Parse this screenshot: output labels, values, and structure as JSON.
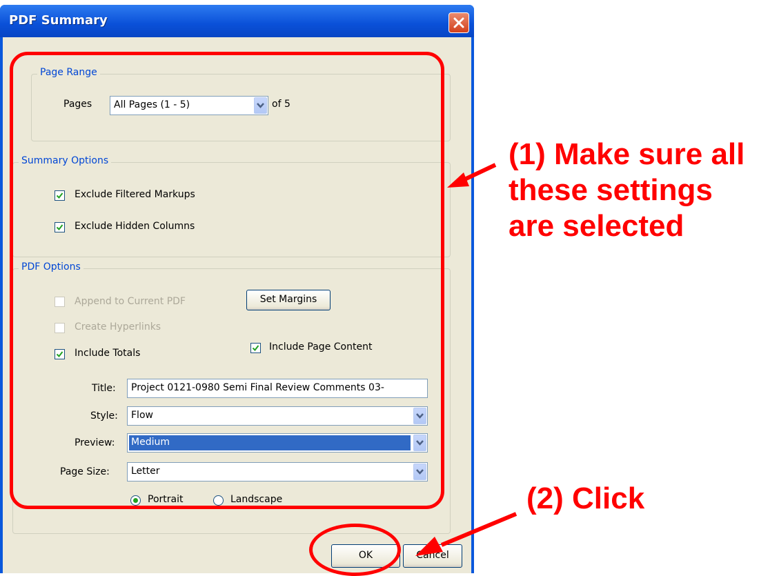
{
  "window": {
    "title": "PDF Summary"
  },
  "page_range": {
    "legend": "Page Range",
    "pages_label": "Pages",
    "pages_value": "All Pages (1 - 5)",
    "of_text": "of 5"
  },
  "summary_options": {
    "legend": "Summary Options",
    "exclude_filtered": {
      "label": "Exclude Filtered Markups",
      "checked": true
    },
    "exclude_hidden": {
      "label": "Exclude Hidden Columns",
      "checked": true
    }
  },
  "pdf_options": {
    "legend": "PDF Options",
    "append": {
      "label": "Append to Current PDF",
      "checked": false,
      "enabled": false
    },
    "set_margins_label": "Set Margins",
    "hyperlinks": {
      "label": "Create Hyperlinks",
      "checked": false,
      "enabled": false
    },
    "include_totals": {
      "label": "Include Totals",
      "checked": true
    },
    "include_page_content": {
      "label": "Include Page Content",
      "checked": true
    },
    "title_label": "Title:",
    "title_value": "Project 0121-0980 Semi Final Review Comments 03-",
    "style_label": "Style:",
    "style_value": "Flow",
    "preview_label": "Preview:",
    "preview_value": "Medium",
    "page_size_label": "Page Size:",
    "page_size_value": "Letter",
    "portrait_label": "Portrait",
    "landscape_label": "Landscape",
    "orientation": "Portrait"
  },
  "buttons": {
    "ok": "OK",
    "cancel": "Cancel"
  },
  "annotations": {
    "step1_line1": "(1) Make sure all",
    "step1_line2": "these settings",
    "step1_line3": "are selected",
    "step2": "(2) Click",
    "color": "#ff0000"
  },
  "colors": {
    "titlebar": "#0a58dc",
    "dialog_bg": "#ece9d8",
    "legend_text": "#0046d5",
    "selection": "#316ac5"
  }
}
